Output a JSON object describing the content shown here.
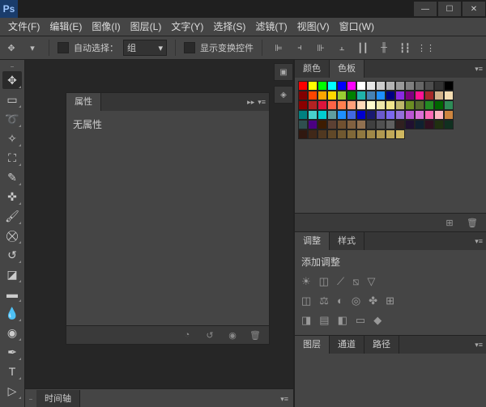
{
  "app": {
    "name": "Ps"
  },
  "window": {
    "min": "—",
    "max": "☐",
    "close": "✕"
  },
  "menu": [
    {
      "label": "文件(F)"
    },
    {
      "label": "编辑(E)"
    },
    {
      "label": "图像(I)"
    },
    {
      "label": "图层(L)"
    },
    {
      "label": "文字(Y)"
    },
    {
      "label": "选择(S)"
    },
    {
      "label": "滤镜(T)"
    },
    {
      "label": "视图(V)"
    },
    {
      "label": "窗口(W)"
    }
  ],
  "options": {
    "auto_select": "自动选择：",
    "group": "组",
    "transform": "显示变换控件"
  },
  "properties": {
    "tab": "属性",
    "none": "无属性"
  },
  "timeline": {
    "label": "时间轴"
  },
  "color_panel": {
    "tab_color": "颜色",
    "tab_swatches": "色板"
  },
  "adjustments": {
    "tab_adj": "调整",
    "tab_styles": "样式",
    "add_label": "添加调整"
  },
  "layers": {
    "tab_layers": "图层",
    "tab_channels": "通道",
    "tab_paths": "路径"
  },
  "swatches": [
    "#ff0000",
    "#ffff00",
    "#00ff00",
    "#00ffff",
    "#0000ff",
    "#ff00ff",
    "#ffffff",
    "#e6e6e6",
    "#cccccc",
    "#b3b3b3",
    "#999999",
    "#7f7f7f",
    "#666666",
    "#4d4d4d",
    "#333333",
    "#000000",
    "#800000",
    "#ff4500",
    "#ffa500",
    "#ffd700",
    "#9acd32",
    "#008000",
    "#20b2aa",
    "#4682b4",
    "#1e90ff",
    "#000080",
    "#8a2be2",
    "#800080",
    "#ff1493",
    "#a52a2a",
    "#d2b48c",
    "#f5deb3",
    "#8b0000",
    "#b22222",
    "#dc143c",
    "#ff6347",
    "#ff7f50",
    "#ffa07a",
    "#ffdab9",
    "#fffacd",
    "#eee8aa",
    "#f0e68c",
    "#bdb76b",
    "#6b8e23",
    "#556b2f",
    "#228b22",
    "#006400",
    "#2e8b57",
    "#008080",
    "#48d1cc",
    "#00ced1",
    "#5f9ea0",
    "#1e90ff",
    "#4169e1",
    "#0000cd",
    "#191970",
    "#6a5acd",
    "#7b68ee",
    "#9370db",
    "#ba55d3",
    "#da70d6",
    "#ff69b4",
    "#ffb6c1",
    "#cd853f",
    "#2f4f4f",
    "#4b0082",
    "#3d1c02",
    "#5c4033",
    "#705030",
    "#806040",
    "#907050",
    "#404040",
    "#505050",
    "#606060",
    "#302020",
    "#201030",
    "#102030",
    "#301020",
    "#203010",
    "#103020",
    "#301810",
    "#402818",
    "#503820",
    "#604828",
    "#705830",
    "#806838",
    "#907840",
    "#a08848",
    "#b09850",
    "#c0a858",
    "#d0b860"
  ]
}
